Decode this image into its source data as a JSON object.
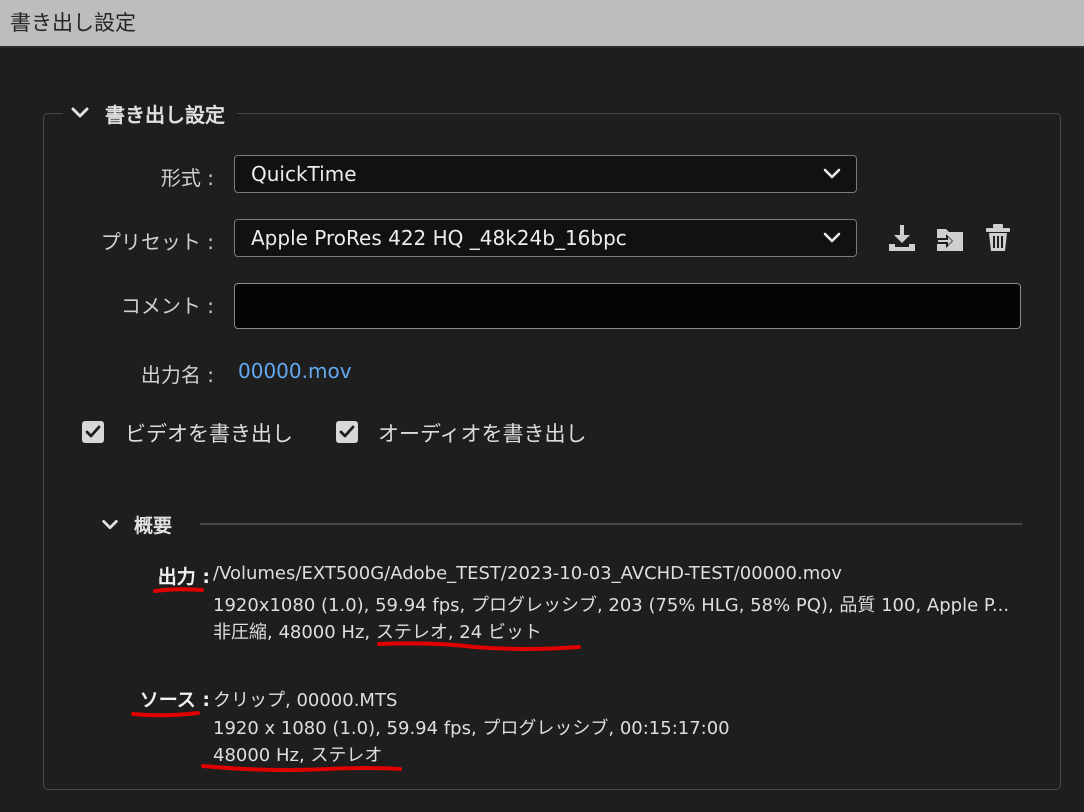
{
  "window": {
    "title": "書き出し設定"
  },
  "section": {
    "title": "書き出し設定"
  },
  "format": {
    "label": "形式 :",
    "value": "QuickTime"
  },
  "preset": {
    "label": "プリセット :",
    "value": "Apple ProRes 422 HQ _48k24b_16bpc"
  },
  "comment": {
    "label": "コメント :",
    "value": ""
  },
  "output_name": {
    "label": "出力名 :",
    "value": "00000.mov"
  },
  "checkboxes": {
    "video": {
      "label": "ビデオを書き出し",
      "checked": true
    },
    "audio": {
      "label": "オーディオを書き出し",
      "checked": true
    }
  },
  "summary": {
    "title": "概要",
    "output": {
      "key": "出力 :",
      "line1": "/Volumes/EXT500G/Adobe_TEST/2023-10-03_AVCHD-TEST/00000.mov",
      "line2": "1920x1080 (1.0), 59.94 fps, プログレッシブ, 203 (75% HLG, 58% PQ), 品質 100, Apple P...",
      "line3": "非圧縮, 48000 Hz, ステレオ, 24 ビット"
    },
    "source": {
      "key": "ソース :",
      "line1": "クリップ, 00000.MTS",
      "line2": "1920 x 1080 (1.0), 59.94 fps, プログレッシブ, 00:15:17:00",
      "line3": "48000 Hz, ステレオ"
    }
  },
  "icons": {
    "save_preset": "download-icon",
    "import_preset": "import-icon",
    "delete_preset": "trash-icon"
  },
  "colors": {
    "link": "#63a9f0",
    "annotation": "#e00000",
    "titlebar": "#bdbdbd"
  }
}
